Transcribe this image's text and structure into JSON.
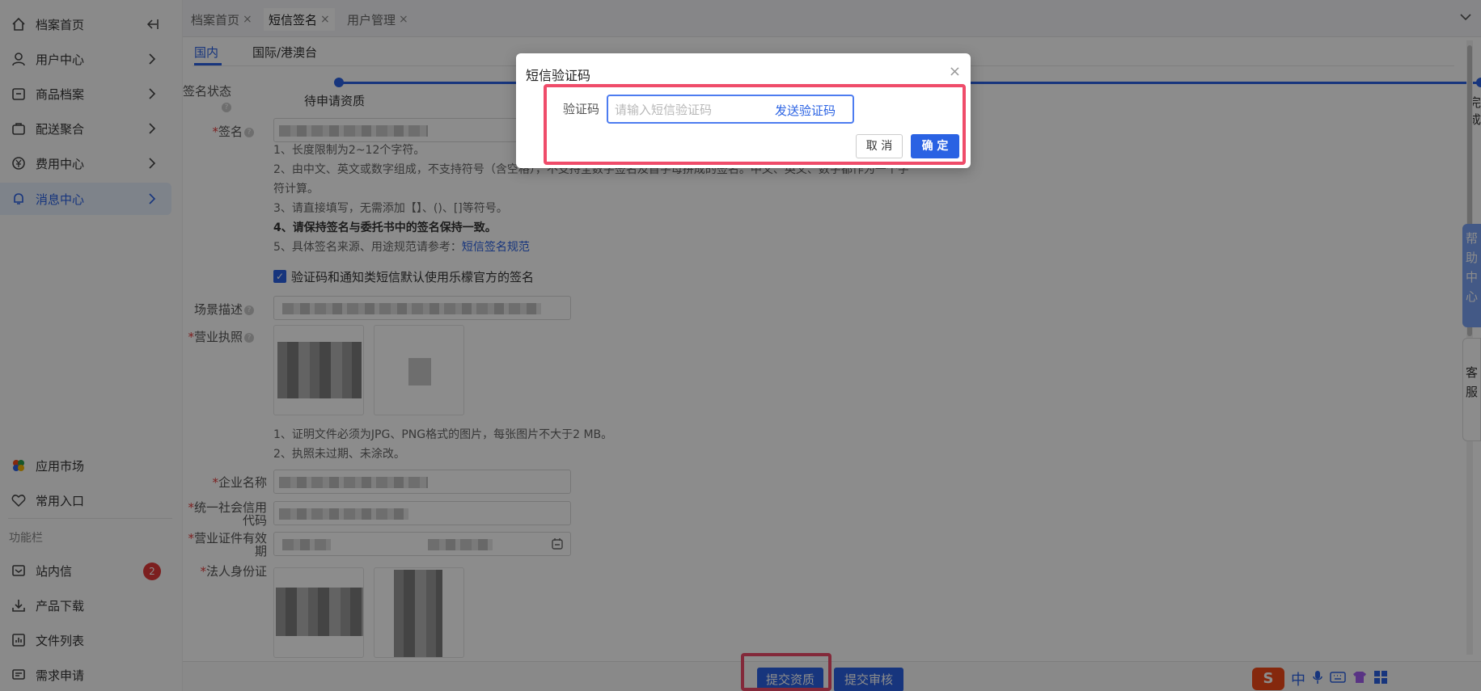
{
  "sidebar": {
    "items": [
      {
        "label": "档案首页",
        "icon": "home-icon"
      },
      {
        "label": "用户中心",
        "icon": "user-icon"
      },
      {
        "label": "商品档案",
        "icon": "product-icon"
      },
      {
        "label": "配送聚合",
        "icon": "delivery-icon"
      },
      {
        "label": "费用中心",
        "icon": "currency-icon"
      },
      {
        "label": "消息中心",
        "icon": "bell-icon"
      }
    ],
    "bottom_items": [
      {
        "label": "应用市场",
        "icon": "app-market-icon"
      },
      {
        "label": "常用入口",
        "icon": "heart-icon"
      }
    ],
    "section_title": "功能栏",
    "function_items": [
      {
        "label": "站内信",
        "icon": "mail-icon",
        "badge": "2"
      },
      {
        "label": "产品下载",
        "icon": "download-icon"
      },
      {
        "label": "文件列表",
        "icon": "file-list-icon"
      },
      {
        "label": "需求申请",
        "icon": "request-icon"
      }
    ]
  },
  "tabs": [
    {
      "label": "档案首页",
      "close": "×"
    },
    {
      "label": "短信签名",
      "close": "×"
    },
    {
      "label": "用户管理",
      "close": "×"
    }
  ],
  "subtabs": [
    "国内",
    "国际/港澳台"
  ],
  "form": {
    "sign_status_label": "签名状态",
    "steps": {
      "start": "待申请资质",
      "end": "完成"
    },
    "signature_label": "签名",
    "signature_help": [
      "1、长度限制为2~12个字符。",
      "2、由中文、英文或数字组成，不支持符号（含空格），不支持全数字签名及首字母拼成的签名。中文、英文、数字都作为一个字",
      "符计算。",
      "3、请直接填写，无需添加【】、()、[]等符号。",
      "4、请保持签名与委托书中的签名保持一致。",
      "5、具体签名来源、用途规范请参考："
    ],
    "signature_link": "短信签名规范",
    "checkbox_label": "验证码和通知类短信默认使用乐檬官方的签名",
    "scene_label": "场景描述",
    "license_label": "营业执照",
    "license_help": [
      "1、证明文件必须为JPG、PNG格式的图片，每张图片不大于2 MB。",
      "2、执照未过期、未涂改。"
    ],
    "company_label": "企业名称",
    "credit_code_label_1": "统一社会信用",
    "credit_code_label_2": "代码",
    "validity_label_1": "营业证件有效",
    "validity_label_2": "期",
    "id_card_label": "法人身份证",
    "required_mark": "*",
    "help_mark": "?"
  },
  "bottom_buttons": {
    "submit_qualification": "提交资质",
    "submit_review": "提交审核"
  },
  "float": {
    "help": "帮助中心",
    "service": "客服"
  },
  "modal": {
    "title": "短信验证码",
    "close": "×",
    "code_label": "验证码",
    "code_placeholder": "请输入短信验证码",
    "send_code": "发送验证码",
    "cancel": "取 消",
    "confirm": "确 定"
  },
  "ime": {
    "logo": "S",
    "lang": "中"
  },
  "colors": {
    "accent": "#2a62e3",
    "highlight": "#ef4c6a",
    "badge": "#e23a3a"
  }
}
